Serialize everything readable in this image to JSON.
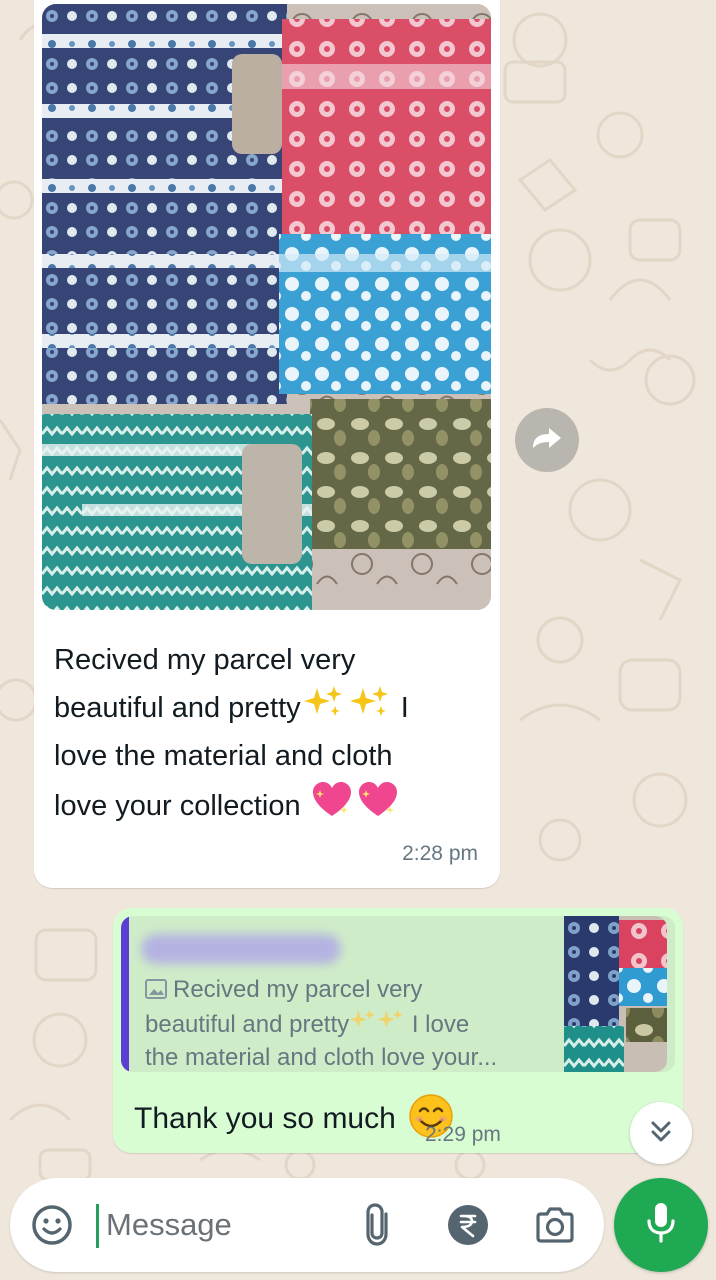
{
  "incoming_message": {
    "caption_line_1": "Recived my parcel very",
    "caption_line_2a": "beautiful and pretty",
    "caption_line_2b": "I",
    "caption_line_3": "love the material and cloth",
    "caption_line_4": "love your collection",
    "time": "2:28 pm"
  },
  "reply": {
    "quoted_line_1": "Recived my parcel very",
    "quoted_line_2a": "beautiful and pretty",
    "quoted_line_2b": "I love",
    "quoted_line_3": "the material and cloth love your...",
    "text": "Thank you so much",
    "time": "2:29 pm"
  },
  "composer": {
    "placeholder": "Message"
  },
  "icons": {
    "forward": "forward-icon",
    "scroll_down": "double-chevron-down-icon",
    "emoji": "emoji-icon",
    "attach": "paperclip-icon",
    "payment": "rupee-icon",
    "camera": "camera-icon",
    "mic": "mic-icon",
    "sparkles": "sparkles-icon",
    "heart": "sparkling-heart-icon",
    "smile": "smiling-face-icon",
    "image": "image-icon"
  },
  "colors": {
    "chat_background": "#efe7dc",
    "incoming_bubble": "#ffffff",
    "outgoing_bubble": "#d9fdd3",
    "quote_bar": "#5b3fd0",
    "accent_green": "#1ea952",
    "meta_text": "#667781"
  }
}
